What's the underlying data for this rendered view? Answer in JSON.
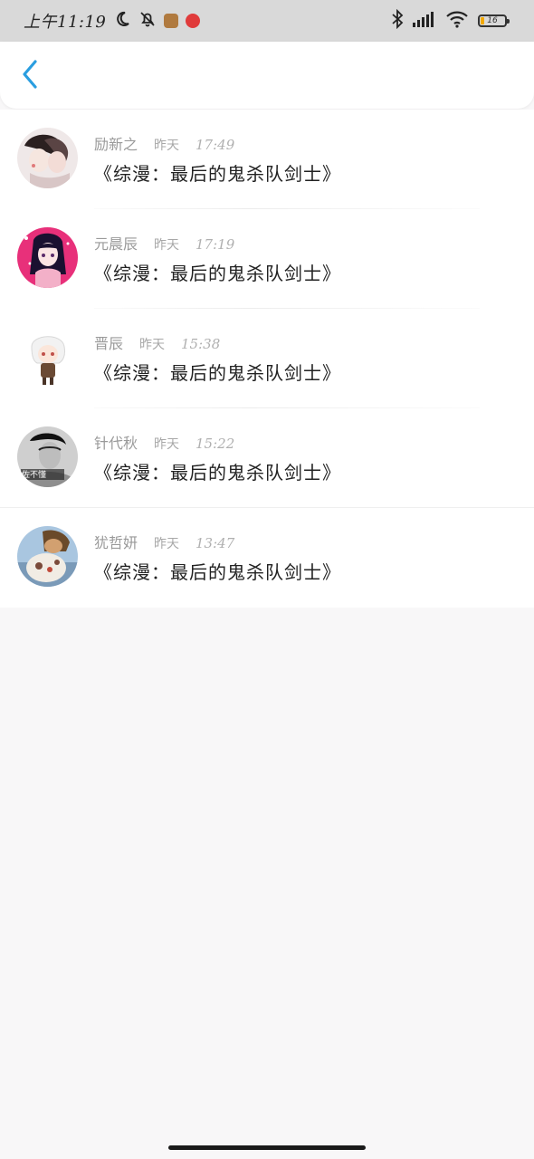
{
  "status_bar": {
    "time": "上午11:19",
    "battery": "16"
  },
  "header": {
    "back_icon": "chevron-left-icon",
    "accent_color": "#2a9ee0"
  },
  "items": [
    {
      "name": "励新之",
      "day": "昨天",
      "time": "17:49",
      "title": "《综漫：最后的鬼杀队剑士》",
      "avatar": "anime-pair"
    },
    {
      "name": "元晨辰",
      "day": "昨天",
      "time": "17:19",
      "title": "《综漫：最后的鬼杀队剑士》",
      "avatar": "anime-girl-pink"
    },
    {
      "name": "晋辰",
      "day": "昨天",
      "time": "15:38",
      "title": "《综漫：最后的鬼杀队剑士》",
      "avatar": "chibi-white-hair"
    },
    {
      "name": "针代秋",
      "day": "昨天",
      "time": "15:22",
      "title": "《综漫：最后的鬼杀队剑士》",
      "avatar": "grayscale-portrait",
      "avatar_caption": "佐不懂"
    },
    {
      "name": "犹哲妍",
      "day": "昨天",
      "time": "13:47",
      "title": "《综漫：最后的鬼杀队剑士》",
      "avatar": "photo-hat"
    }
  ]
}
